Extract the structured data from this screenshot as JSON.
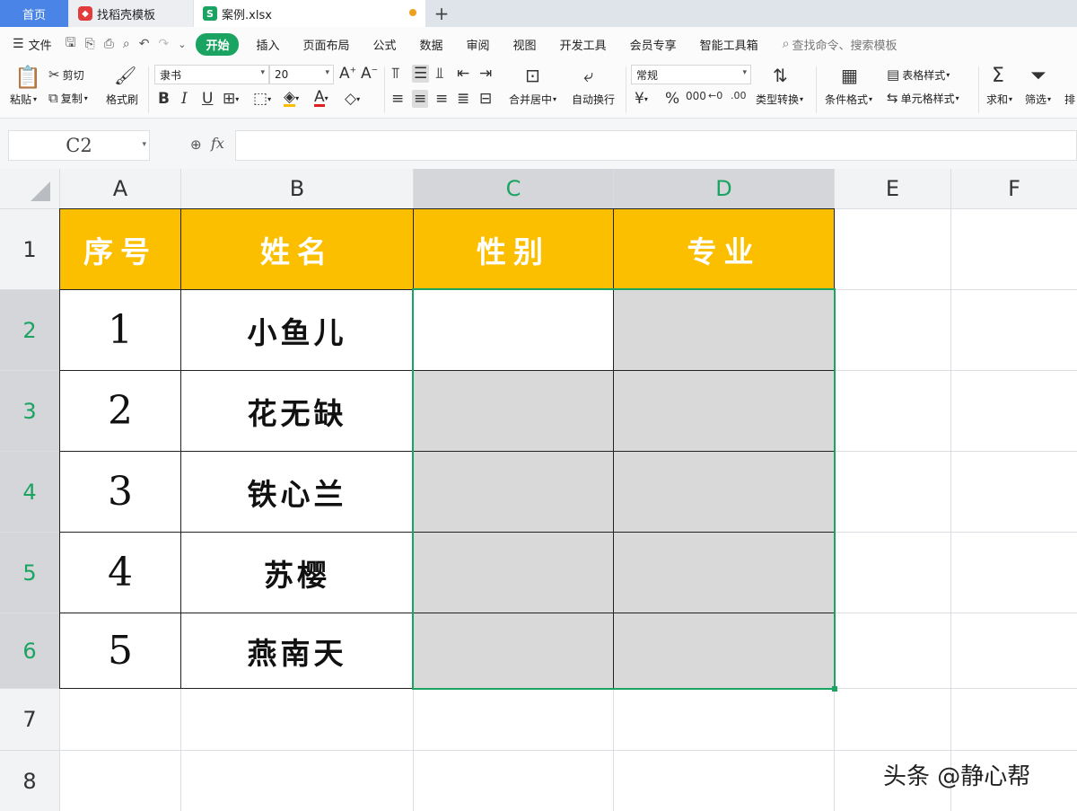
{
  "tabs": [
    {
      "label": "首页"
    },
    {
      "label": "找稻壳模板"
    },
    {
      "label": "案例.xlsx"
    }
  ],
  "menu": {
    "file": "文件",
    "items": [
      "开始",
      "插入",
      "页面布局",
      "公式",
      "数据",
      "审阅",
      "视图",
      "开发工具",
      "会员专享",
      "智能工具箱"
    ],
    "search_placeholder": "查找命令、搜索模板"
  },
  "ribbon": {
    "paste": "粘贴",
    "cut": "剪切",
    "copy": "复制",
    "format_painter": "格式刷",
    "font_name": "隶书",
    "font_size": "20",
    "merge_center": "合并居中",
    "wrap_text": "自动换行",
    "number_format": "常规",
    "type_convert": "类型转换",
    "conditional_format": "条件格式",
    "table_style": "表格样式",
    "cell_style": "单元格样式",
    "sum": "求和",
    "filter": "筛选",
    "sort": "排"
  },
  "formula_bar": {
    "name_box": "C2",
    "fx": "fx",
    "value": ""
  },
  "columns": [
    "A",
    "B",
    "C",
    "D",
    "E",
    "F"
  ],
  "rows": [
    "1",
    "2",
    "3",
    "4",
    "5",
    "6",
    "7",
    "8"
  ],
  "table": {
    "headers": [
      "序号",
      "姓名",
      "性别",
      "专业"
    ],
    "records": [
      {
        "num": "1",
        "name": "小鱼儿"
      },
      {
        "num": "2",
        "name": "花无缺"
      },
      {
        "num": "3",
        "name": "铁心兰"
      },
      {
        "num": "4",
        "name": "苏樱"
      },
      {
        "num": "5",
        "name": "燕南天"
      }
    ]
  },
  "watermark": "头条 @静心帮",
  "colors": {
    "accent": "#1aa361",
    "header_fill": "#fcbf00",
    "selection_fill": "#d9d9d9",
    "home_tab": "#4a84e6"
  }
}
